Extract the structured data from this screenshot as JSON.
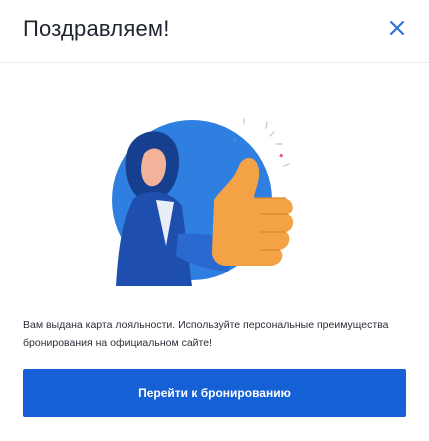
{
  "dialog": {
    "title": "Поздравляем!",
    "message": "Вам выдана карта лояльности. Используйте персональные преимущества бронирования на официальном сайте!",
    "cta_label": "Перейти к бронированию"
  },
  "icons": {
    "close": "close-icon",
    "illustration": "thumbs-up-illustration"
  },
  "colors": {
    "accent": "#1560d4",
    "illustration_blue": "#2f80e0",
    "illustration_orange": "#f2a64a"
  }
}
